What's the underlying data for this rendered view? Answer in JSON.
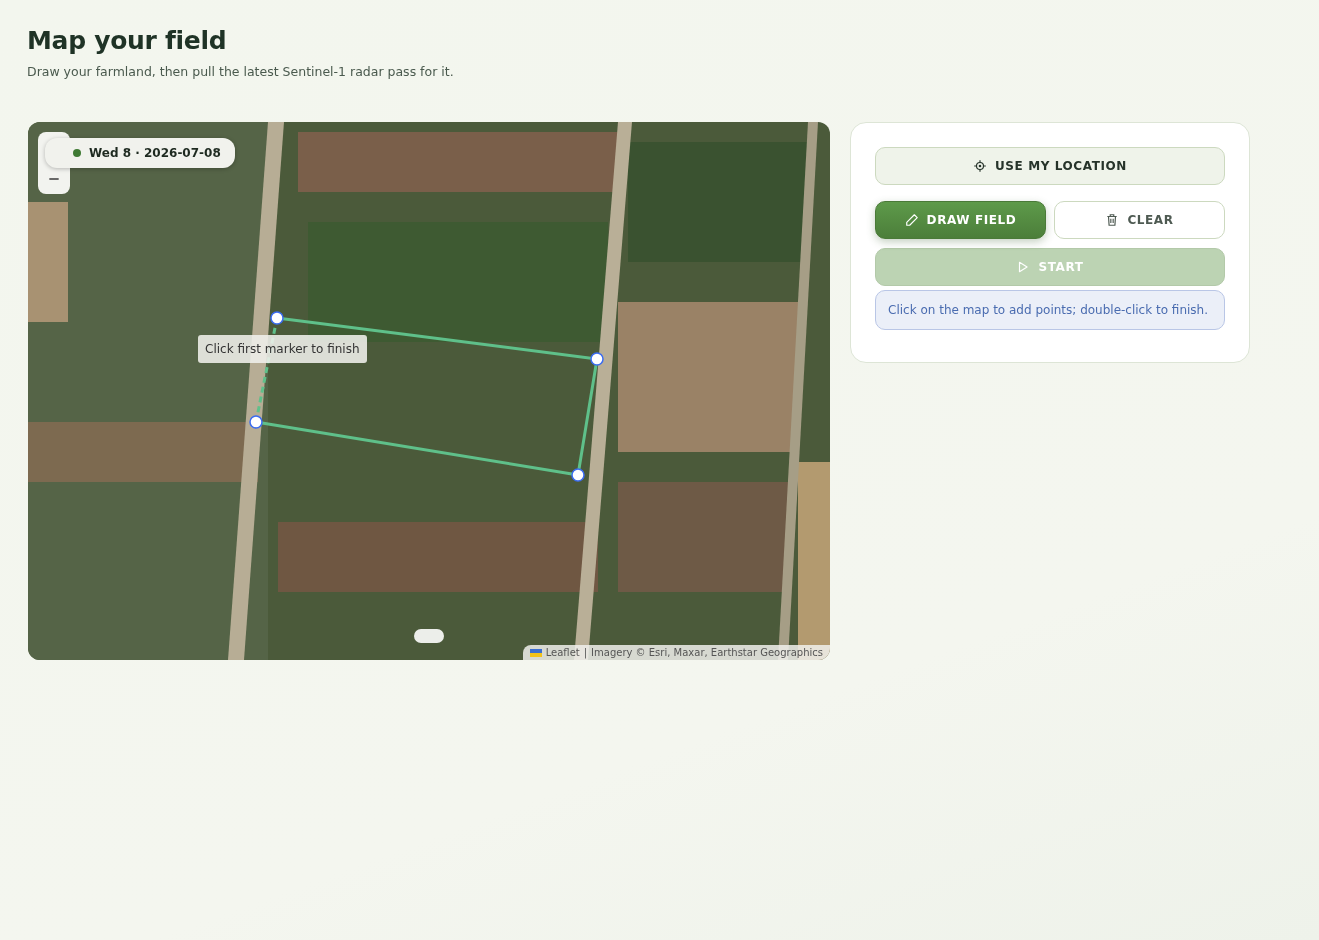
{
  "header": {
    "title": "Map your field",
    "subtitle": "Draw your farmland, then pull the latest Sentinel-1 radar pass for it."
  },
  "map": {
    "date_chip": "Wed 8 · 2026-07-08",
    "tooltip": "Click first marker to finish",
    "attribution": {
      "source": "Leaflet",
      "separator": "|",
      "text": "Imagery © Esri, Maxar, Earthstar Geographics"
    }
  },
  "controls": {
    "location_button": {
      "label": "USE MY LOCATION"
    },
    "draw_button": {
      "label": "DRAW FIELD",
      "active": true
    },
    "clear_button": {
      "label": "CLEAR",
      "active": false
    },
    "start_button": {
      "label": "START",
      "disabled": true
    },
    "hint": "Click on the map to add points; double-click to finish."
  }
}
